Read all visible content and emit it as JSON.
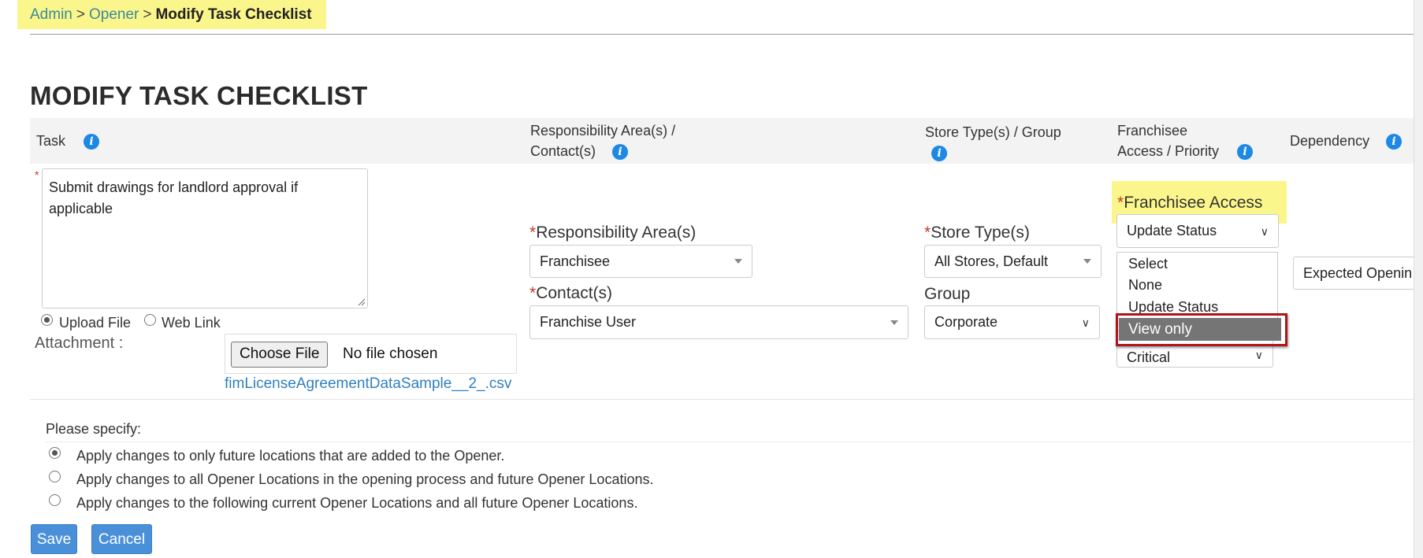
{
  "breadcrumb": {
    "item1": "Admin",
    "sep": ">",
    "item2": "Opener",
    "current": "Modify Task Checklist"
  },
  "page_title": "MODIFY TASK CHECKLIST",
  "table_headers": {
    "task": "Task",
    "responsibility": "Responsibility Area(s) /",
    "responsibility_line2": "Contact(s)",
    "store_type": "Store Type(s) / Group",
    "franchisee_access": "Franchisee",
    "franchisee_access_line2": "Access / Priority",
    "dependency": "Dependency"
  },
  "task": {
    "required_mark": "*",
    "text": "Submit drawings for landlord approval if applicable",
    "upload_file_label": "Upload File",
    "web_link_label": "Web Link",
    "attachment_label": "Attachment :",
    "choose_file_label": "Choose File",
    "no_file_text": "No file chosen",
    "file_link": "fimLicenseAgreementDataSample__2_.csv"
  },
  "responsibility": {
    "area_label": "Responsibility Area(s)",
    "area_value": "Franchisee",
    "contact_label": "Contact(s)",
    "contact_value": "Franchise User"
  },
  "store": {
    "type_label": "Store Type(s)",
    "type_value": "All Stores, Default",
    "group_label": "Group",
    "group_value": "Corporate"
  },
  "franchisee_access": {
    "label": "Franchisee Access",
    "selected": "Update Status",
    "options": [
      "Select",
      "None",
      "Update Status",
      "View only"
    ],
    "highlighted_option": "View only",
    "priority_value": "Critical"
  },
  "dependency": {
    "value": "Expected Openin"
  },
  "specify": {
    "label": "Please specify:",
    "options": [
      "Apply changes to only future locations that are added to the Opener.",
      "Apply changes to all Opener Locations in the opening process and future Opener Locations.",
      "Apply changes to the following current Opener Locations and all future Opener Locations."
    ]
  },
  "buttons": {
    "save": "Save",
    "cancel": "Cancel"
  },
  "colors": {
    "accent": "#4a90d9",
    "highlight": "#fbf68b",
    "required": "#c0392b",
    "focus_ring": "#b01515"
  }
}
